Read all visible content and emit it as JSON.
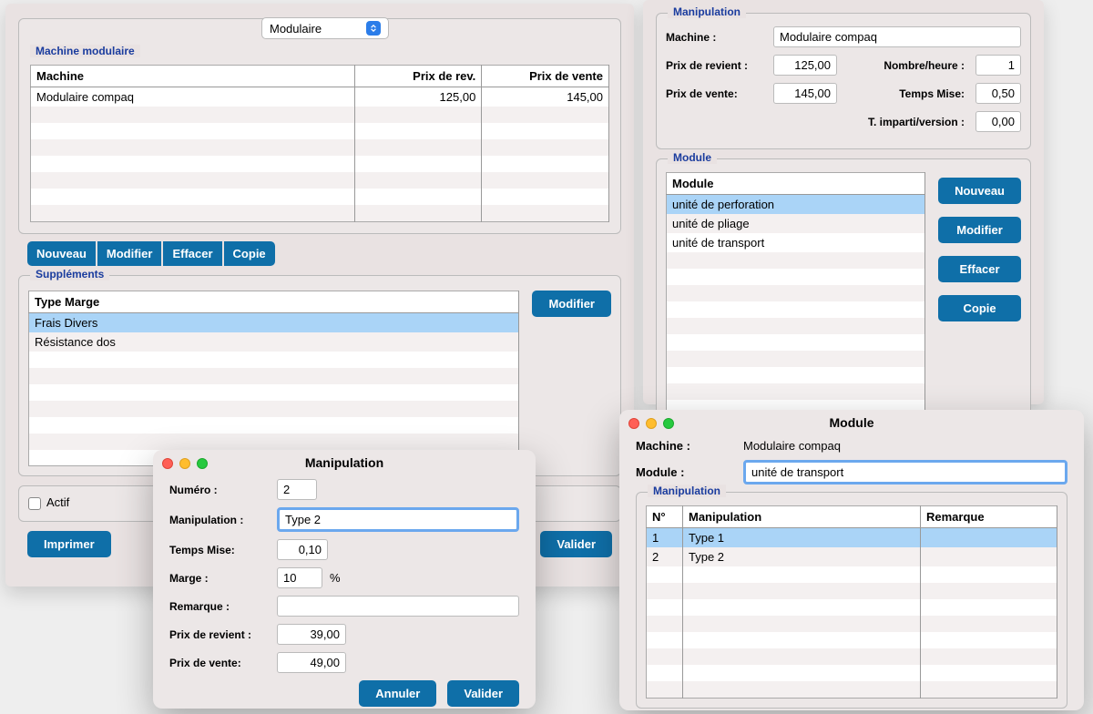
{
  "dropdown": {
    "value": "Modulaire"
  },
  "machineMod": {
    "title": "Machine modulaire",
    "cols": [
      "Machine",
      "Prix de rev.",
      "Prix de vente"
    ],
    "rows": [
      {
        "name": "Modulaire compaq",
        "rev": "125,00",
        "vente": "145,00"
      }
    ]
  },
  "btns": {
    "nouveau": "Nouveau",
    "modifier": "Modifier",
    "effacer": "Effacer",
    "copie": "Copie",
    "annuler": "Annuler",
    "valider": "Valider",
    "imprimer": "Imprimer"
  },
  "supp": {
    "title": "Suppléments",
    "col": "Type Marge",
    "rows": [
      "Frais Divers",
      "Résistance dos"
    ]
  },
  "actif": "Actif",
  "manipPanel": {
    "title": "Manipulation",
    "labels": {
      "machine": "Machine :",
      "rev": "Prix de revient :",
      "vente": "Prix de vente:",
      "nbh": "Nombre/heure :",
      "temps": "Temps Mise:",
      "imp": "T. imparti/version :"
    },
    "values": {
      "machine": "Modulaire compaq",
      "rev": "125,00",
      "vente": "145,00",
      "nbh": "1",
      "temps": "0,50",
      "imp": "0,00"
    }
  },
  "modulePanel": {
    "title": "Module",
    "col": "Module",
    "rows": [
      "unité de perforation",
      "unité de pliage",
      "unité de transport"
    ]
  },
  "manipModal": {
    "title": "Manipulation",
    "fields": {
      "numero": {
        "label": "Numéro :",
        "value": "2"
      },
      "manip": {
        "label": "Manipulation :",
        "value": "Type 2"
      },
      "temps": {
        "label": "Temps Mise:",
        "value": "0,10"
      },
      "marge": {
        "label": "Marge :",
        "value": "10",
        "unit": "%"
      },
      "remarque": {
        "label": "Remarque :",
        "value": ""
      },
      "rev": {
        "label": "Prix de revient :",
        "value": "39,00"
      },
      "vente": {
        "label": "Prix de vente:",
        "value": "49,00"
      }
    }
  },
  "moduleModal": {
    "title": "Module",
    "machineLabel": "Machine :",
    "machine": "Modulaire compaq",
    "moduleLabel": "Module :",
    "module": "unité de transport",
    "section": "Manipulation",
    "cols": [
      "N°",
      "Manipulation",
      "Remarque"
    ],
    "rows": [
      {
        "n": "1",
        "m": "Type 1",
        "r": ""
      },
      {
        "n": "2",
        "m": "Type 2",
        "r": ""
      }
    ]
  }
}
